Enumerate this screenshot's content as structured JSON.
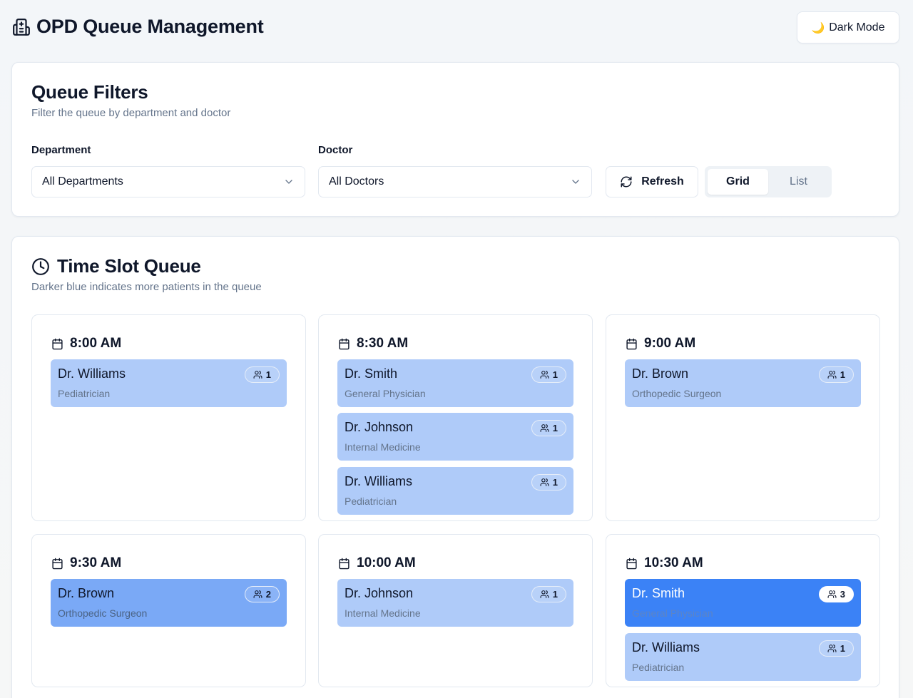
{
  "header": {
    "title": "OPD Queue Management",
    "dark_mode_label": "Dark Mode"
  },
  "filters": {
    "title": "Queue Filters",
    "subtitle": "Filter the queue by department and doctor",
    "department_label": "Department",
    "department_value": "All Departments",
    "doctor_label": "Doctor",
    "doctor_value": "All Doctors",
    "refresh_label": "Refresh",
    "view_options": [
      "Grid",
      "List"
    ],
    "active_view": "Grid"
  },
  "queue": {
    "title": "Time Slot Queue",
    "subtitle": "Darker blue indicates more patients in the queue",
    "colors": {
      "low": "#afcbf9",
      "medium": "#7aa9f6",
      "high": "#3b82f6"
    },
    "slots": [
      {
        "time": "8:00 AM",
        "doctors": [
          {
            "name": "Dr. Williams",
            "specialty": "Pediatrician",
            "count": "1"
          }
        ]
      },
      {
        "time": "8:30 AM",
        "doctors": [
          {
            "name": "Dr. Smith",
            "specialty": "General Physician",
            "count": "1"
          },
          {
            "name": "Dr. Johnson",
            "specialty": "Internal Medicine",
            "count": "1"
          },
          {
            "name": "Dr. Williams",
            "specialty": "Pediatrician",
            "count": "1"
          }
        ]
      },
      {
        "time": "9:00 AM",
        "doctors": [
          {
            "name": "Dr. Brown",
            "specialty": "Orthopedic Surgeon",
            "count": "1"
          }
        ]
      },
      {
        "time": "9:30 AM",
        "doctors": [
          {
            "name": "Dr. Brown",
            "specialty": "Orthopedic Surgeon",
            "count": "2"
          }
        ]
      },
      {
        "time": "10:00 AM",
        "doctors": [
          {
            "name": "Dr. Johnson",
            "specialty": "Internal Medicine",
            "count": "1"
          }
        ]
      },
      {
        "time": "10:30 AM",
        "doctors": [
          {
            "name": "Dr. Smith",
            "specialty": "General Physician",
            "count": "3"
          },
          {
            "name": "Dr. Williams",
            "specialty": "Pediatrician",
            "count": "1"
          }
        ]
      }
    ]
  }
}
